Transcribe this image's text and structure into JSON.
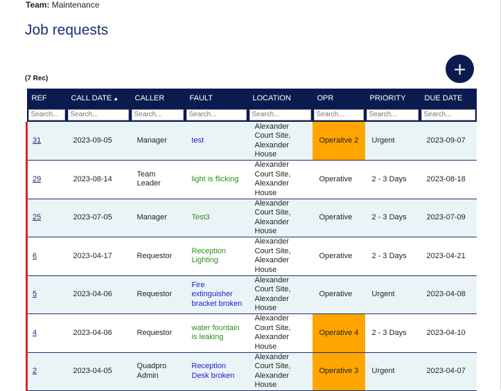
{
  "team": {
    "label": "Team:",
    "value": "Maintenance"
  },
  "page_title": "Job requests",
  "record_count": "(7 Rec)",
  "add_button": "+",
  "columns": [
    "REF",
    "CALL DATE",
    "CALLER",
    "FAULT",
    "LOCATION",
    "OPR",
    "PRIORITY",
    "DUE DATE"
  ],
  "sort_indicator": "▲",
  "search_placeholder": "Search...",
  "rows": [
    {
      "ref": "31",
      "call_date": "2023-09-05",
      "caller": "Manager",
      "fault": "test",
      "location": "Alexander Court Site, Alexander House",
      "opr": "Operaitve 2",
      "priority": "Urgent",
      "due_date": "2023-09-07"
    },
    {
      "ref": "29",
      "call_date": "2023-08-14",
      "caller": "Team Leader",
      "fault": "light is flicking",
      "location": "Alexander Court Site, Alexander House",
      "opr": "Operative",
      "priority": "2 - 3 Days",
      "due_date": "2023-08-18"
    },
    {
      "ref": "25",
      "call_date": "2023-07-05",
      "caller": "Manager",
      "fault": "Test3",
      "location": "Alexander Court Site, Alexander House",
      "opr": "Operative",
      "priority": "2 - 3 Days",
      "due_date": "2023-07-09"
    },
    {
      "ref": "6",
      "call_date": "2023-04-17",
      "caller": "Requestor",
      "fault": "Reception Lighting",
      "location": "Alexander Court Site, Alexander House",
      "opr": "Operative",
      "priority": "2 - 3 Days",
      "due_date": "2023-04-21"
    },
    {
      "ref": "5",
      "call_date": "2023-04-06",
      "caller": "Requestor",
      "fault": "Fire extinguisher bracket broken",
      "location": "Alexander Court Site, Alexander House",
      "opr": "Operative",
      "priority": "Urgent",
      "due_date": "2023-04-08"
    },
    {
      "ref": "4",
      "call_date": "2023-04-06",
      "caller": "Requestor",
      "fault": "water fountain is leaking",
      "location": "Alexander Court Site, Alexander House",
      "opr": "Operative 4",
      "priority": "2 - 3 Days",
      "due_date": "2023-04-10"
    },
    {
      "ref": "2",
      "call_date": "2023-04-05",
      "caller": "Quadpro Admin",
      "fault": "Reception Desk broken",
      "location": "Alexander Court Site, Alexander House",
      "opr": "Operative 3",
      "priority": "Urgent",
      "due_date": "2023-04-07"
    }
  ],
  "colors": {
    "header_bg": "#0b1b4f",
    "accent_orange": "#ffa500",
    "status_red": "#e02020",
    "fault_blue": "#1a1ad0",
    "fault_green": "#2e8b1e"
  }
}
